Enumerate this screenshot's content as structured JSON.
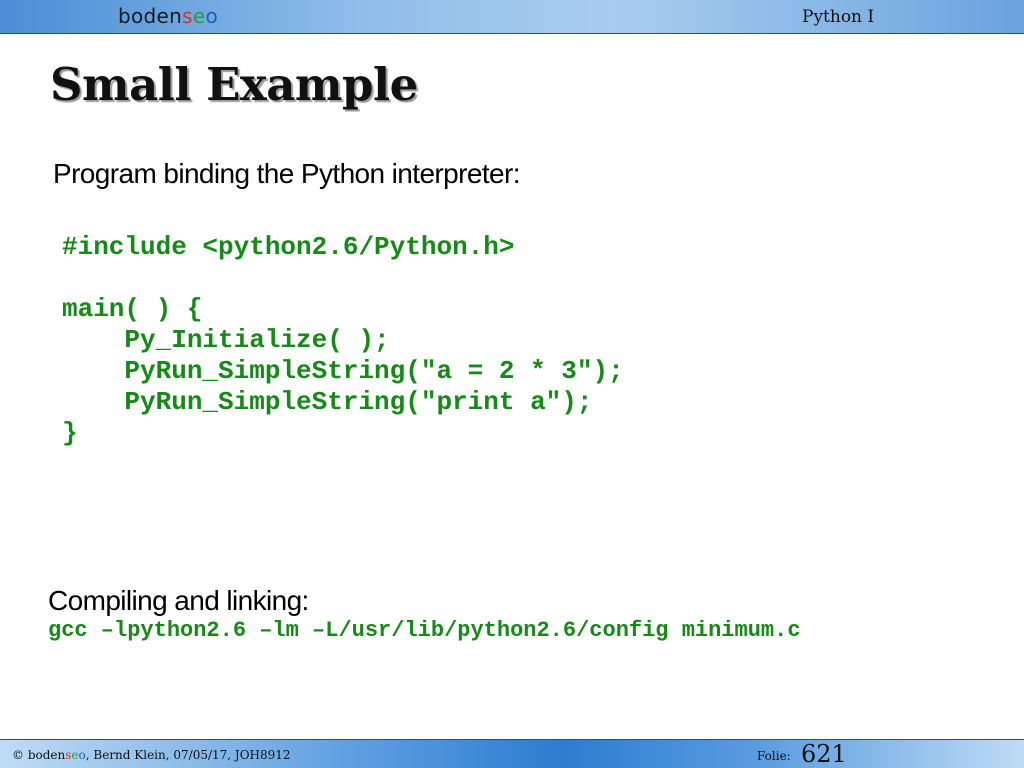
{
  "header": {
    "logo_text": "bodenseo",
    "logo_parts": [
      "boden",
      "s",
      "e",
      "o"
    ],
    "course_title": "Python I"
  },
  "slide": {
    "title": "Small Example",
    "intro_text": "Program binding the Python interpreter:",
    "code_lines": [
      "#include <python2.6/Python.h>",
      "",
      "main( ) {",
      "    Py_Initialize( );",
      "    PyRun_SimpleString(\"a = 2 * 3\");",
      "    PyRun_SimpleString(\"print a\");",
      "}"
    ],
    "compile_label": "Compiling and linking:",
    "compile_command": "gcc –lpython2.6 –lm –L/usr/lib/python2.6/config minimum.c"
  },
  "footer": {
    "copyright_prefix": "© ",
    "brand_parts": [
      "boden",
      "s",
      "e",
      "o"
    ],
    "info": ", Bernd Klein, 07/05/17, JOH8912",
    "folie_label": "Folie:",
    "folie_number": "621"
  },
  "colors": {
    "code_green": "#168a16",
    "logo_s": "#d4322c",
    "logo_e": "#2f9a3a",
    "logo_o": "#1c5fb8",
    "bar_blue": "#2c7cd0"
  }
}
